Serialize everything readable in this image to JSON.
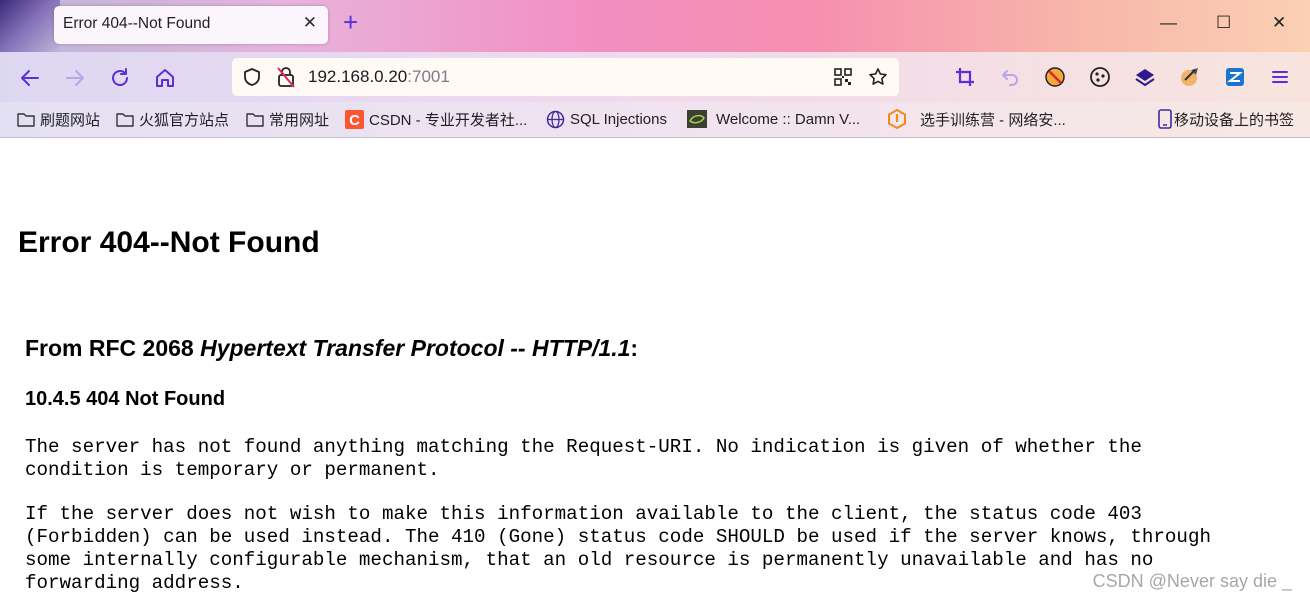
{
  "browser": {
    "tab_title": "Error 404--Not Found",
    "tab_close": "✕",
    "new_tab": "+",
    "window": {
      "minimize": "—",
      "maximize": "☐",
      "close": "✕"
    },
    "url_host": "192.168.0.20",
    "url_port": ":7001",
    "accent_color": "#5c2fd6"
  },
  "bookmarks": [
    {
      "label": "刷题网站",
      "icon": "folder-icon"
    },
    {
      "label": "火狐官方站点",
      "icon": "folder-icon"
    },
    {
      "label": "常用网址",
      "icon": "folder-icon"
    },
    {
      "label": "CSDN - 专业开发者社...",
      "icon": "csdn-icon"
    },
    {
      "label": "SQL Injections",
      "icon": "globe-icon"
    },
    {
      "label": "Welcome :: Damn V...",
      "icon": "dvwa-icon"
    },
    {
      "label": "选手训练营 - 网络安...",
      "icon": "training-icon"
    },
    {
      "label": "移动设备上的书签",
      "icon": "mobile-bookmarks-icon"
    }
  ],
  "page": {
    "title": "Error 404--Not Found",
    "rfc_prefix": "From RFC 2068 ",
    "rfc_italic": "Hypertext Transfer Protocol -- HTTP/1.1",
    "rfc_suffix": ":",
    "section": "10.4.5 404 Not Found",
    "para1": "The server has not found anything matching the Request-URI. No indication is given of whether the\ncondition is temporary or permanent.",
    "para2": "If the server does not wish to make this information available to the client, the status code 403\n(Forbidden) can be used instead. The 410 (Gone) status code SHOULD be used if the server knows, through\nsome internally configurable mechanism, that an old resource is permanently unavailable and has no\nforwarding address."
  },
  "watermark": "CSDN @Never say die _"
}
